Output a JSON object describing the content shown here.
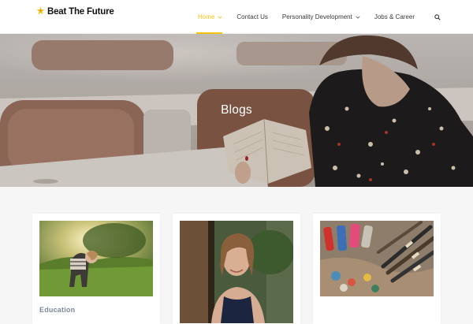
{
  "header": {
    "logo_text": "Beat The Future",
    "nav": {
      "home": "Home",
      "contact": "Contact Us",
      "personality": "Personality Development",
      "jobs": "Jobs & Career"
    }
  },
  "hero": {
    "title": "Blogs"
  },
  "cards": [
    {
      "category": "Education"
    },
    {
      "category": ""
    },
    {
      "category": ""
    }
  ],
  "colors": {
    "accent": "#f1c40f",
    "category_text": "#7c8a99"
  },
  "icons": {
    "logo": "logo-icon",
    "dropdown": "chevron-down-icon",
    "search": "search-icon"
  }
}
